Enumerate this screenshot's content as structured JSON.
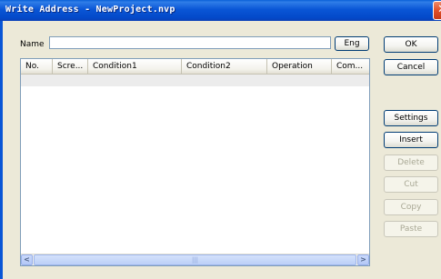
{
  "window": {
    "title": "Write Address - NewProject.nvp",
    "close_glyph": "✕"
  },
  "name_field": {
    "label": "Name",
    "value": ""
  },
  "eng_button": "Eng",
  "list": {
    "columns": [
      "No.",
      "Scre...",
      "Condition1",
      "Condition2",
      "Operation",
      "Com..."
    ],
    "scroll_left": "<",
    "scroll_right": ">",
    "thumb_grip": "|||"
  },
  "buttons": {
    "ok": "OK",
    "cancel": "Cancel",
    "settings": "Settings",
    "insert": "Insert",
    "delete": "Delete",
    "cut": "Cut",
    "copy": "Copy",
    "paste": "Paste"
  }
}
